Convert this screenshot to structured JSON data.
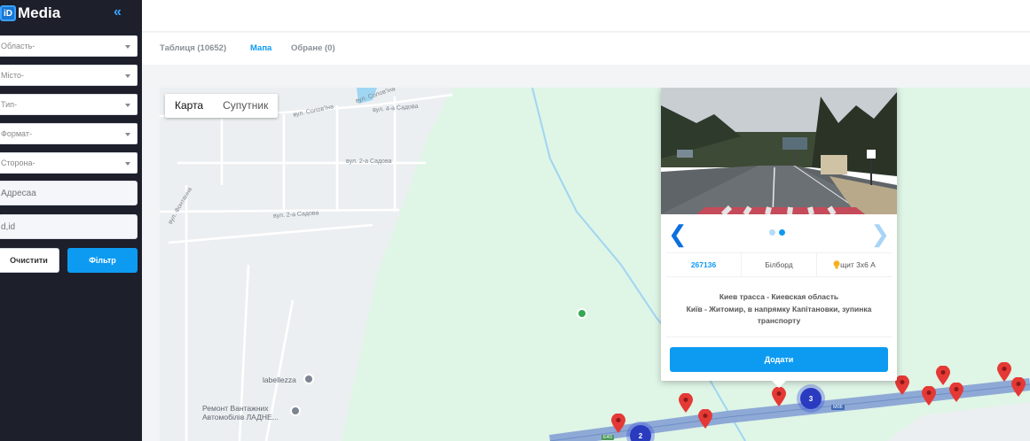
{
  "app": {
    "logo_badge": "iD",
    "logo_text": "Media",
    "collapse_glyph": "«"
  },
  "filters": {
    "region": "Область-",
    "city": "Місто-",
    "type": "Тип-",
    "format": "Формат-",
    "side": "Сторона-",
    "address_placeholder": "Адресаа",
    "id_placeholder": "d,id",
    "clear_label": "Очистити",
    "filter_label": "Фільтр"
  },
  "tabs": [
    {
      "label": "Таблиця (10652)",
      "active": false
    },
    {
      "label": "Мапа",
      "active": true
    },
    {
      "label": "Обране (0)",
      "active": false
    }
  ],
  "map": {
    "toggle": {
      "map_label": "Карта",
      "satellite_label": "Супутник"
    },
    "streets": [
      "вул. Солов'їна",
      "вул. 4-а Садова",
      "вул. 2-а Садова",
      "вул. 2-а Садова",
      "вул. Фонтанна",
      "вул. Солов'їна"
    ],
    "pois": [
      "labellezza",
      "Ремонт Вантажних",
      "Автомобілів ЛАДНЕ..."
    ],
    "road_labels": [
      "M06",
      "E40"
    ],
    "clusters": [
      "3",
      "2"
    ]
  },
  "card": {
    "id": "267136",
    "type": "Білборд",
    "format": "щит 3х6 А",
    "address_line1": "Киев трасса - Киевская область",
    "address_line2": "Київ - Житомир, в напрямку Капітановки, зупинка транспорту",
    "add_label": "Додати",
    "prev_glyph": "❮",
    "next_glyph": "❯"
  },
  "colors": {
    "accent": "#0d9bf2",
    "sidebar": "#1d1f2b",
    "pin": "#e53935",
    "cluster": "#2b3bbf"
  }
}
